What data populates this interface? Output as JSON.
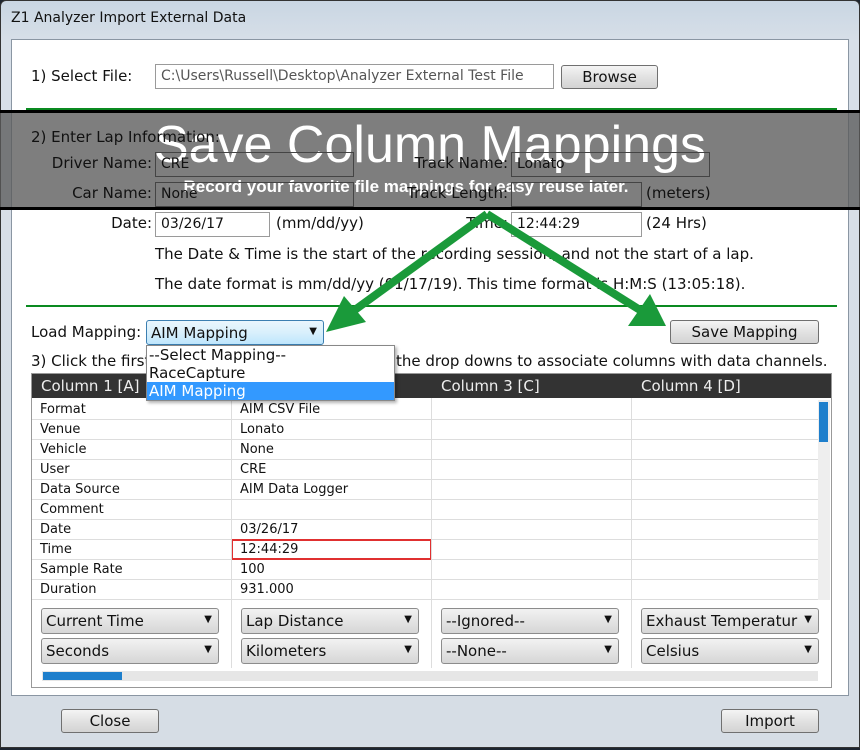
{
  "window": {
    "title": "Z1 Analyzer Import External Data"
  },
  "file": {
    "label": "1) Select File:",
    "path": "C:\\Users\\Russell\\Desktop\\Analyzer External Test File",
    "browse": "Browse"
  },
  "lap": {
    "heading": "2) Enter Lap Information:",
    "driver_label": "Driver Name:",
    "driver": "CRE",
    "track_label": "Track Name:",
    "track": "Lonato",
    "car_label": "Car Name:",
    "car": "None",
    "length_label": "Track Length:",
    "length": "",
    "length_unit": "(meters)",
    "date_label": "Date:",
    "date": "03/26/17",
    "date_fmt": "(mm/dd/yy)",
    "time_label": "Time:",
    "time": "12:44:29",
    "time_fmt": "(24 Hrs)",
    "note1": "The Date & Time is the start of the recording session, and not the start of a lap.",
    "note2": "The date format is mm/dd/yy (01/17/19). This time format is H:M:S (13:05:18)."
  },
  "mapping": {
    "label": "Load Mapping:",
    "selected": "AIM Mapping",
    "save": "Save Mapping",
    "options": [
      "--Select Mapping--",
      "RaceCapture",
      "AIM Mapping"
    ]
  },
  "step3": {
    "start": "3) Click the first",
    "end": "the drop downs to associate columns with data channels."
  },
  "table": {
    "headers": [
      "Column 1 [A]",
      "",
      "Column 3 [C]",
      "Column 4 [D]"
    ],
    "rows": [
      [
        "Format",
        "AIM CSV File"
      ],
      [
        "Venue",
        "Lonato"
      ],
      [
        "Vehicle",
        "None"
      ],
      [
        "User",
        "CRE"
      ],
      [
        "Data Source",
        "AIM Data Logger"
      ],
      [
        "Comment",
        ""
      ],
      [
        "Date",
        "03/26/17"
      ],
      [
        "Time",
        "12:44:29"
      ],
      [
        "Sample Rate",
        "100"
      ],
      [
        "Duration",
        "931.000"
      ]
    ],
    "channels": [
      "Current Time",
      "Lap Distance",
      "--Ignored--",
      "Exhaust Temperatur"
    ],
    "units": [
      "Seconds",
      "Kilometers",
      "--None--",
      "Celsius"
    ],
    "hscroll_position": 0.05
  },
  "footer": {
    "close": "Close",
    "import": "Import"
  },
  "callout": {
    "title": "Save Column Mappings",
    "subtitle": "Record your favorite file mappings for easy reuse later.",
    "arrow_color": "#1a9a3a"
  }
}
